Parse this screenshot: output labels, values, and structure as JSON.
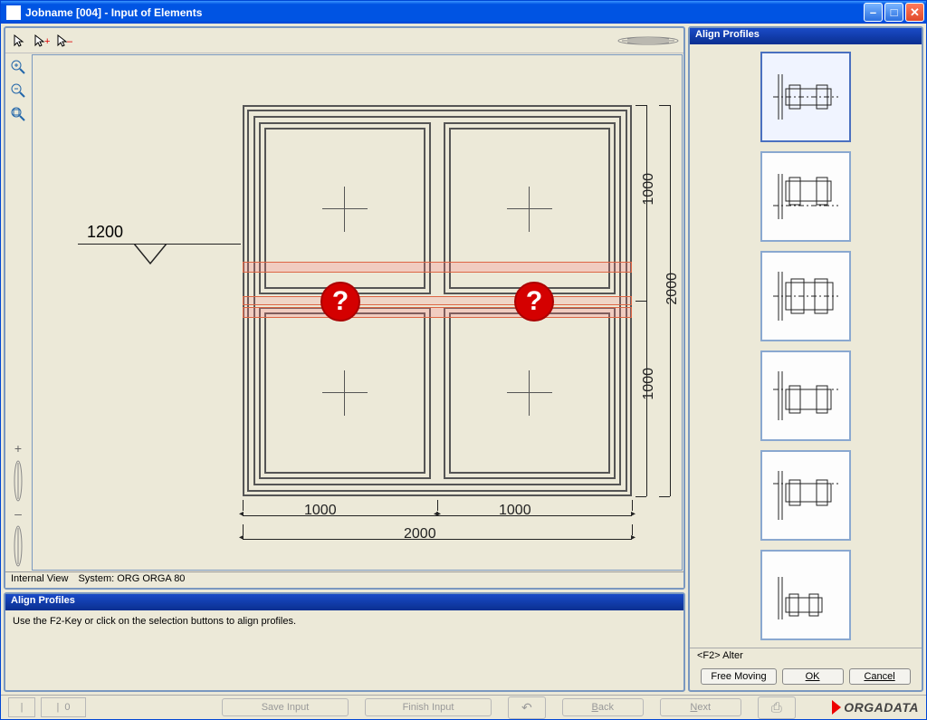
{
  "window": {
    "title": "Jobname [004] - Input of Elements"
  },
  "status": {
    "viewLabel": "Internal View",
    "systemLabel": "System: ORG ORGA 80"
  },
  "infoPanel": {
    "title": "Align Profiles",
    "hint": "Use the F2-Key or click on the selection buttons to align profiles."
  },
  "rightPanel": {
    "title": "Align Profiles",
    "f2Hint": "<F2> Alter",
    "buttons": {
      "freeMoving": "Free Moving",
      "ok": "OK",
      "cancel": "Cancel"
    }
  },
  "bottom": {
    "saveInput": "Save Input",
    "finishInput": "Finish Input",
    "back": "Back",
    "next": "Next",
    "brand": "ORGADATA",
    "zero": "0"
  },
  "drawing": {
    "level": "1200",
    "totalWidth": "2000",
    "totalHeight": "2000",
    "halfWidth": "1000",
    "halfHeight": "1000"
  }
}
